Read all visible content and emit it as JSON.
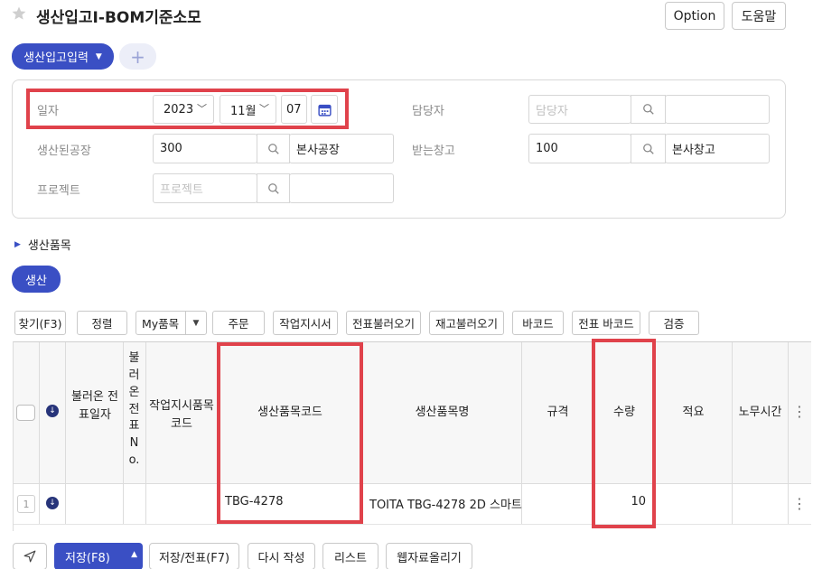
{
  "header": {
    "title": "생산입고I-BOM기준소모",
    "option_label": "Option",
    "help_label": "도움말"
  },
  "tabs": {
    "main_label": "생산입고입력",
    "add_label": "+"
  },
  "form": {
    "date_label": "일자",
    "year": "2023",
    "month": "11월",
    "day": "07",
    "manager_label": "담당자",
    "manager_placeholder": "담당자",
    "factory_label": "생산된공장",
    "factory_code": "300",
    "factory_name": "본사공장",
    "warehouse_label": "받는창고",
    "warehouse_code": "100",
    "warehouse_name": "본사창고",
    "project_label": "프로젝트",
    "project_placeholder": "프로젝트"
  },
  "section": {
    "items_label": "생산품목",
    "produce_label": "생산"
  },
  "toolbar": {
    "find": "찾기(F3)",
    "sort": "정렬",
    "my_items": "My품목",
    "order": "주문",
    "work_order": "작업지시서",
    "load_slip": "전표불러오기",
    "load_stock": "재고불러오기",
    "barcode": "바코드",
    "slip_barcode": "전표 바코드",
    "verify": "검증"
  },
  "table": {
    "headers": {
      "loaded_date": "불러온 전표일자",
      "loaded_no": "불러온전표No.",
      "work_item_code": "작업지시품목코드",
      "item_code": "생산품목코드",
      "item_name": "생산품목명",
      "spec": "규격",
      "qty": "수량",
      "remarks": "적요",
      "labor_time": "노무시간"
    },
    "rows": [
      {
        "num": "1",
        "item_code": "TBG-4278",
        "item_name": "TOITA TBG-4278 2D 스마트",
        "qty": "10"
      }
    ]
  },
  "footer": {
    "save": "저장(F8)",
    "save_slip": "저장/전표(F7)",
    "rewrite": "다시 작성",
    "list": "리스트",
    "web_upload": "웹자료올리기"
  },
  "colors": {
    "accent": "#3a4fc4",
    "highlight": "#e0424b"
  },
  "icons": [
    "star-icon",
    "caret-down-icon",
    "chevron-down-icon",
    "calendar-icon",
    "search-icon",
    "triangle-right-icon",
    "arrow-down-circle-icon",
    "kebab-icon",
    "send-icon",
    "caret-up-icon"
  ]
}
